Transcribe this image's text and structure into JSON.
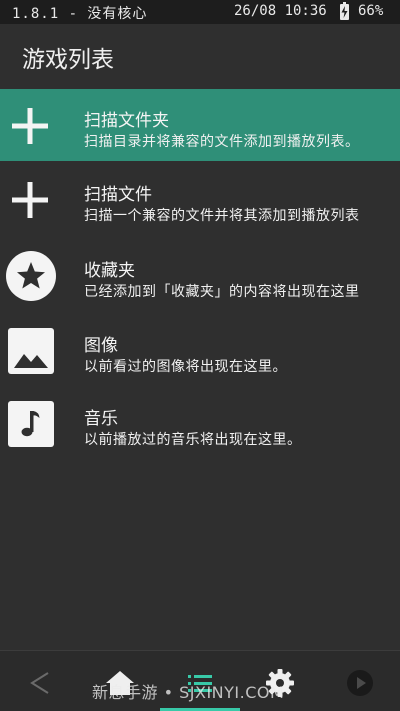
{
  "statusbar": {
    "left_text": "1.8.1 - 没有核心",
    "clock": "26/08 10:36",
    "battery": "66%"
  },
  "appbar": {
    "title": "游戏列表"
  },
  "list": {
    "items": [
      {
        "title": "扫描文件夹",
        "subtitle": "扫描目录并将兼容的文件添加到播放列表。",
        "icon": "add-icon"
      },
      {
        "title": "扫描文件",
        "subtitle": "扫描一个兼容的文件并将其添加到播放列表",
        "icon": "add-icon"
      },
      {
        "title": "收藏夹",
        "subtitle": "已经添加到「收藏夹」的内容将出现在这里",
        "icon": "star-icon"
      },
      {
        "title": "图像",
        "subtitle": "以前看过的图像将出现在这里。",
        "icon": "image-icon"
      },
      {
        "title": "音乐",
        "subtitle": "以前播放过的音乐将出现在这里。",
        "icon": "music-icon"
      }
    ]
  },
  "bottomnav": {
    "items": [
      "back-icon",
      "home-icon",
      "list-icon",
      "settings-icon",
      "play-icon"
    ],
    "active": "list-icon"
  },
  "watermark": "新息手游 • SJXINYI.COM",
  "colors": {
    "background": "#2f2f2f",
    "selected": "#2f8f78",
    "accent": "#38c9a8"
  }
}
